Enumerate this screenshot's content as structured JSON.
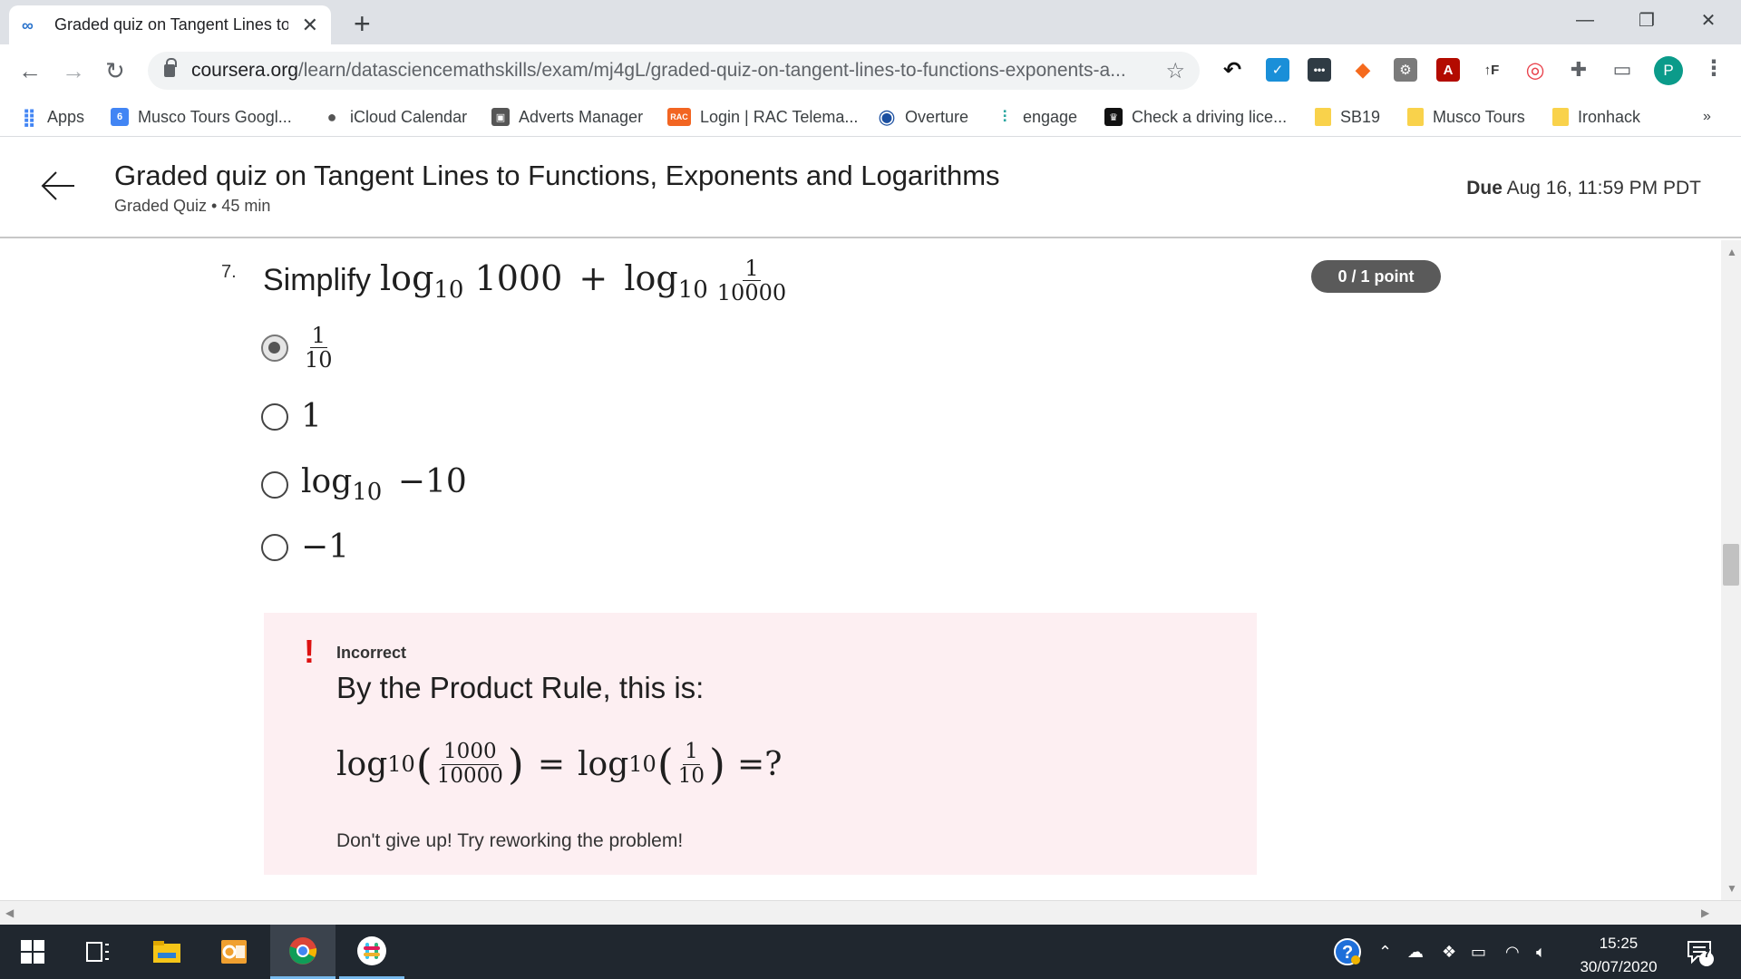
{
  "browser": {
    "tab_title": "Graded quiz on Tangent Lines to Functions, Exponents and Logarithms",
    "url_host": "coursera.org",
    "url_path": "/learn/datasciencemathskills/exam/mj4gL/graded-quiz-on-tangent-lines-to-functions-exponents-a...",
    "profile_initial": "P",
    "bookmarks": [
      {
        "label": "Apps"
      },
      {
        "label": "Musco Tours Googl..."
      },
      {
        "label": "iCloud Calendar"
      },
      {
        "label": "Adverts Manager"
      },
      {
        "label": "Login | RAC Telema..."
      },
      {
        "label": "Overture"
      },
      {
        "label": "engage"
      },
      {
        "label": "Check a driving lice..."
      },
      {
        "label": "SB19"
      },
      {
        "label": "Musco Tours"
      },
      {
        "label": "Ironhack"
      }
    ],
    "bookmark_icon_texts": {
      "calendar": "6",
      "rac": "RAC"
    },
    "more_bookmarks": "»"
  },
  "header": {
    "title": "Graded quiz on Tangent Lines to Functions, Exponents and Logarithms",
    "subtitle": "Graded Quiz • 45 min",
    "due_label": "Due",
    "due_value": "Aug 16, 11:59 PM PDT"
  },
  "question": {
    "number": "7.",
    "prompt_word": "Simplify",
    "math": {
      "log": "log",
      "base": "10",
      "arg1": "1000",
      "plus": "+",
      "frac_num": "1",
      "frac_den": "10000"
    },
    "points": "0 / 1 point",
    "options": [
      {
        "type": "fraction",
        "num": "1",
        "den": "10",
        "selected": true
      },
      {
        "text": "1",
        "selected": false
      },
      {
        "log": "log",
        "base": "10",
        "text": "−10",
        "selected": false
      },
      {
        "text": "−1",
        "selected": false
      }
    ]
  },
  "feedback": {
    "mark": "!",
    "status": "Incorrect",
    "text": "By the Product Rule, this is:",
    "math": {
      "log": "log",
      "base": "10",
      "frac1_num": "1000",
      "frac1_den": "10000",
      "equals": "=",
      "frac2_num": "1",
      "frac2_den": "10",
      "end": "=?"
    },
    "hint": "Don't give up! Try reworking the problem!"
  },
  "taskbar": {
    "time": "15:25",
    "date": "30/07/2020",
    "notifications": "7"
  },
  "colors": {
    "feedback_bg": "#fdeff2",
    "incorrect_red": "#dd1111",
    "points_badge": "#5a5a5a",
    "taskbar": "#20272f"
  }
}
